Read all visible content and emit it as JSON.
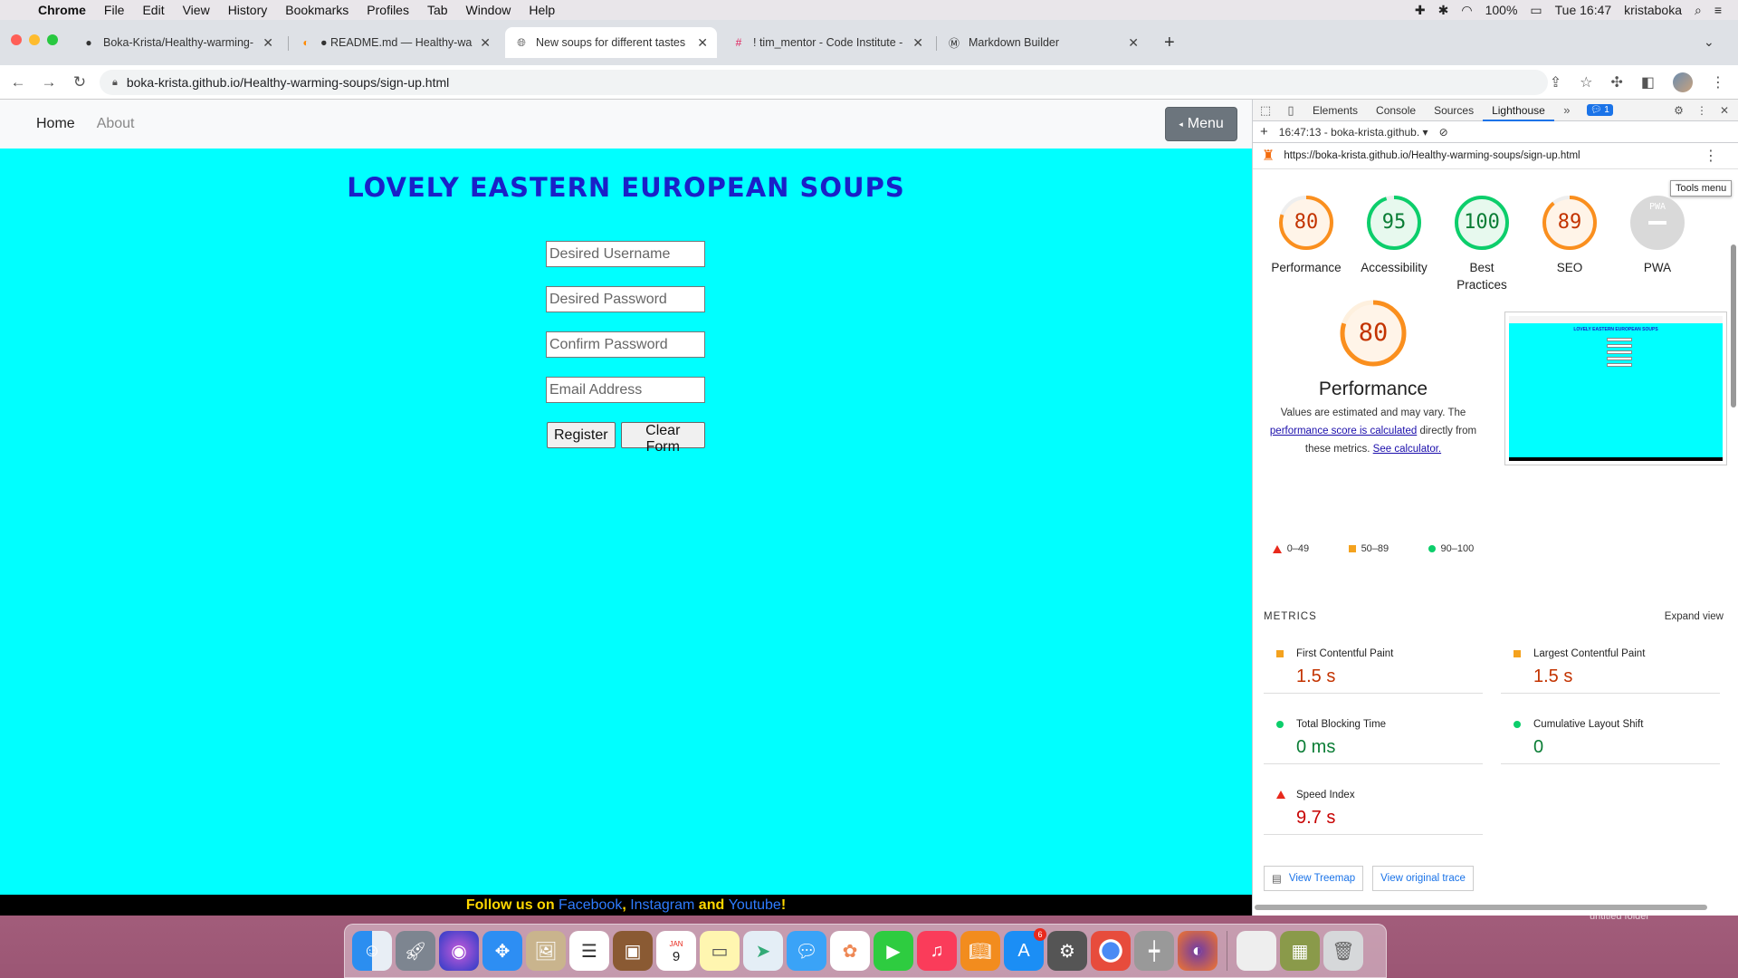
{
  "menubar": {
    "app": "Chrome",
    "items": [
      "File",
      "Edit",
      "View",
      "History",
      "Bookmarks",
      "Profiles",
      "Tab",
      "Window",
      "Help"
    ],
    "battery": "100%",
    "clock": "Tue 16:47",
    "user": "kristaboka"
  },
  "tabs": [
    {
      "title": "Boka-Krista/Healthy-warming-",
      "icon": "github-icon"
    },
    {
      "title": "● README.md — Healthy-war",
      "icon": "gitpod-icon"
    },
    {
      "title": "New soups for different tastes",
      "icon": "globe-icon",
      "active": true
    },
    {
      "title": "! tim_mentor - Code Institute -",
      "icon": "slack-icon"
    },
    {
      "title": "Markdown Builder",
      "icon": "markdown-icon"
    }
  ],
  "toolbar": {
    "url": "boka-krista.github.io/Healthy-warming-soups/sign-up.html"
  },
  "site": {
    "nav": {
      "home": "Home",
      "about": "About",
      "menu": "Menu"
    },
    "title": "LOVELY EASTERN EUROPEAN SOUPS",
    "form": {
      "username_placeholder": "Desired Username",
      "password_placeholder": "Desired Password",
      "confirm_placeholder": "Confirm Password",
      "email_placeholder": "Email Address",
      "register": "Register",
      "clear": "Clear Form"
    },
    "footer": {
      "prefix": "Follow us on ",
      "facebook": "Facebook",
      "comma": ", ",
      "instagram": "Instagram",
      "and": " and ",
      "youtube": "Youtube",
      "suffix": "!"
    }
  },
  "devtools": {
    "tabs": [
      "Elements",
      "Console",
      "Sources",
      "Lighthouse"
    ],
    "active_tab": "Lighthouse",
    "issues_badge": "1",
    "report_selector": "16:47:13 - boka-krista.github.",
    "lh_url": "https://boka-krista.github.io/Healthy-warming-soups/sign-up.html",
    "tooltip": "Tools menu",
    "scores": [
      {
        "label": "Performance",
        "value": "80",
        "score": 0.8,
        "color": "#fa8f1e"
      },
      {
        "label": "Accessibility",
        "value": "95",
        "score": 0.95,
        "color": "#0cce6b"
      },
      {
        "label": "Best Practices",
        "value": "100",
        "score": 1.0,
        "color": "#0cce6b"
      },
      {
        "label": "SEO",
        "value": "89",
        "score": 0.89,
        "color": "#fa8f1e"
      },
      {
        "label": "PWA",
        "value": "PWA",
        "score": 0,
        "color": "#bbbbbb"
      }
    ],
    "perf": {
      "score": "80",
      "title": "Performance",
      "desc_1": "Values are estimated and may vary. The ",
      "desc_link": "performance score is calculated",
      "desc_2": " directly from these metrics. ",
      "desc_link2": "See calculator.",
      "legend": [
        "0–49",
        "50–89",
        "90–100"
      ]
    },
    "metrics_heading": "METRICS",
    "expand_view": "Expand view",
    "metrics": [
      {
        "name": "First Contentful Paint",
        "value": "1.5 s",
        "status": "average"
      },
      {
        "name": "Largest Contentful Paint",
        "value": "1.5 s",
        "status": "average"
      },
      {
        "name": "Total Blocking Time",
        "value": "0 ms",
        "status": "pass"
      },
      {
        "name": "Cumulative Layout Shift",
        "value": "0",
        "status": "pass"
      },
      {
        "name": "Speed Index",
        "value": "9.7 s",
        "status": "fail"
      }
    ],
    "buttons": {
      "treemap": "View Treemap",
      "trace": "View original trace"
    }
  },
  "dock": {
    "calendar_month": "JAN",
    "calendar_day": "9",
    "appstore_badge": "6",
    "desktop_label": "untitled folder"
  }
}
